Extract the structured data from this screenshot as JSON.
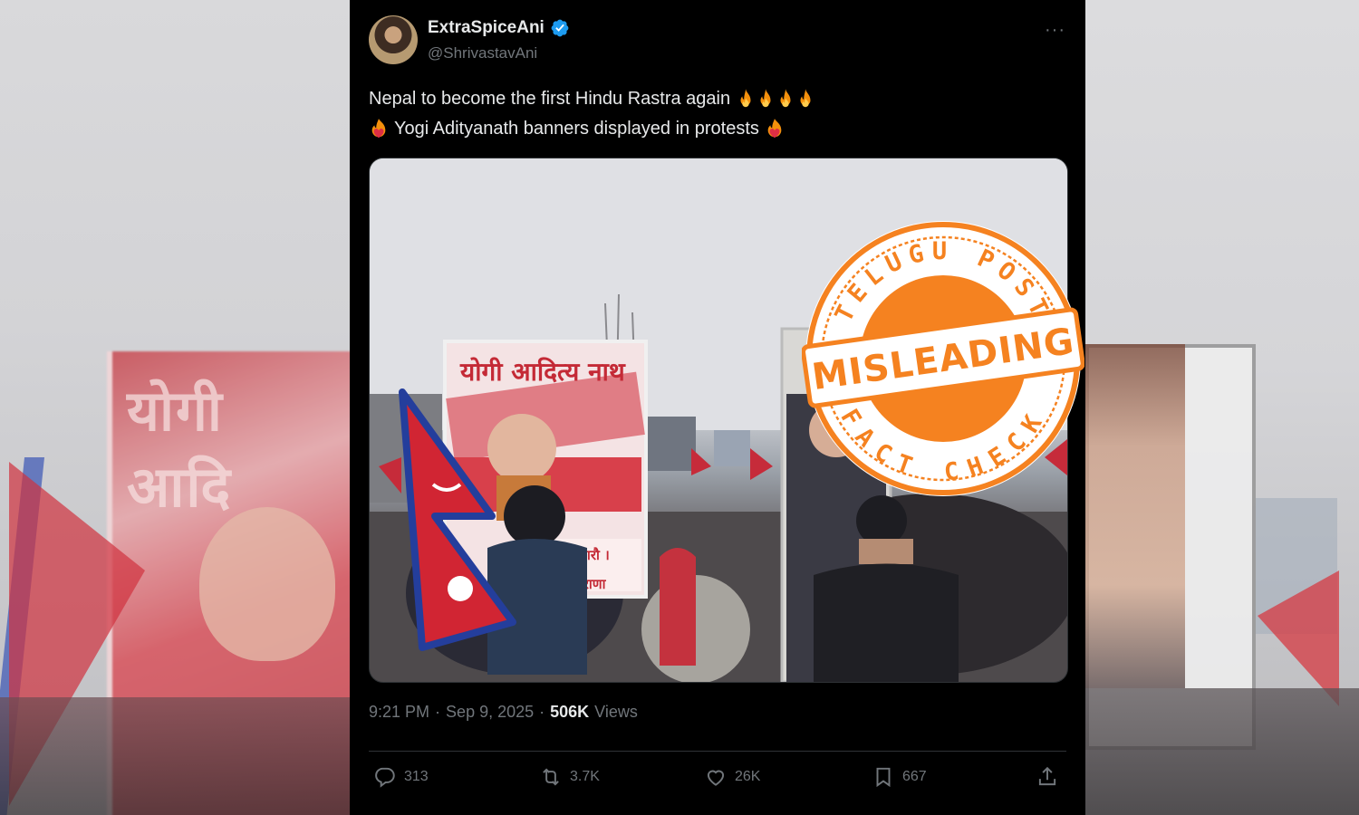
{
  "post": {
    "display_name": "ExtraSpiceAni",
    "handle": "@ShrivastavAni",
    "verified_icon": "verified-badge-icon",
    "more_label": "···",
    "text_line1": "Nepal to become the first Hindu Rastra again",
    "text_line2": "Yogi Adityanath banners displayed in protests",
    "emoji_line1": [
      "fire-emoji",
      "fire-emoji",
      "fire-emoji",
      "fire-emoji"
    ],
    "emoji_line2": [
      "fire-heart-emoji",
      "fire-heart-emoji"
    ],
    "media": {
      "banner_text": "योगी आदित्य नाथ",
      "banner_bottom_1": "ना गरौ ।",
      "banner_bottom_2": "त राणा"
    },
    "time": "9:21 PM",
    "sep1": "·",
    "date": "Sep 9, 2025",
    "sep2": "·",
    "views_count": "506K",
    "views_label": "Views"
  },
  "actions": {
    "replies": "313",
    "reposts": "3.7K",
    "likes": "26K",
    "bookmarks": "667"
  },
  "stamp": {
    "top_text": "TELUGU POST",
    "verdict": "MISLEADING",
    "bottom_text": "FACT CHECK",
    "color": "#f58220"
  },
  "background": {
    "left_banner_text": "योगी आदि"
  },
  "colors": {
    "card_bg": "#000000",
    "text_primary": "#e7e9ea",
    "text_secondary": "#71767b",
    "verified": "#1d9bf0",
    "stamp_orange": "#f58220"
  }
}
